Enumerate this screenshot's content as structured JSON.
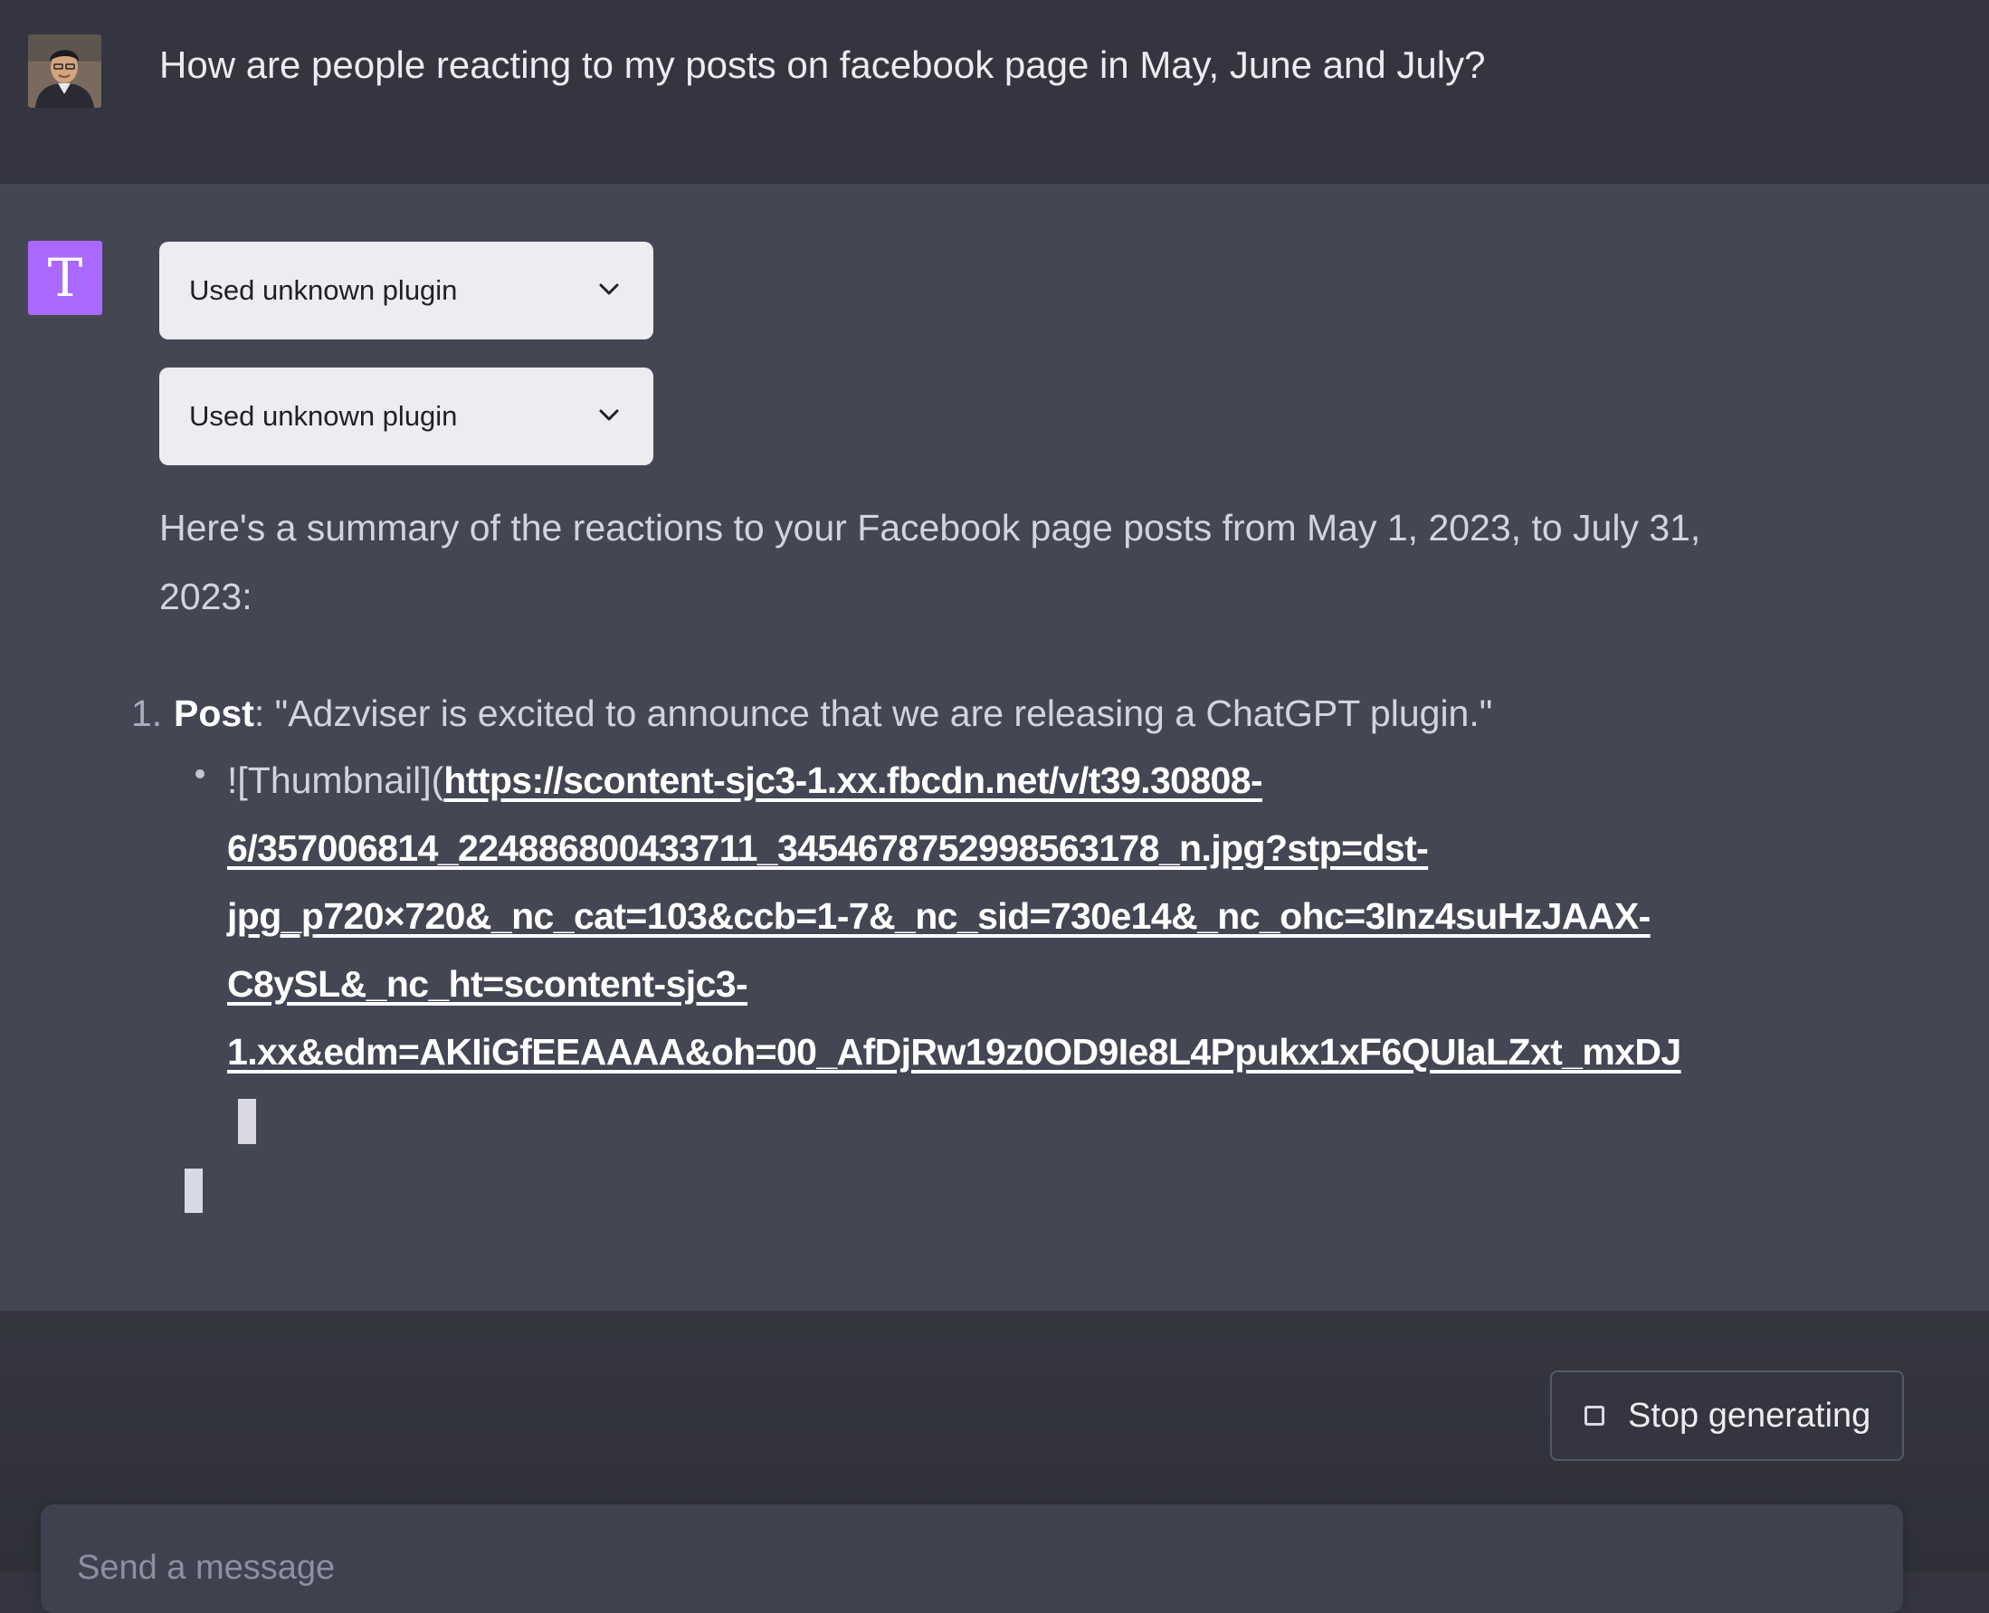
{
  "user_message": {
    "text": "How are people reacting to my posts on facebook page in May, June and July?"
  },
  "assistant": {
    "avatar_letter": "T",
    "plugins": [
      {
        "label": "Used unknown plugin",
        "icon": "chevron-down-icon"
      },
      {
        "label": "Used unknown plugin",
        "icon": "chevron-down-icon"
      }
    ],
    "summary": "Here's a summary of the reactions to your Facebook page posts from May 1, 2023, to July 31, 2023:",
    "list": {
      "number": "1.",
      "post_label": "Post",
      "post_text": ": \"Adzviser is excited to announce that we are releasing a ChatGPT plugin.\"",
      "thumbnail_prefix": "![Thumbnail](",
      "url_lines": [
        "https://scontent-sjc3-1.xx.fbcdn.net/v/t39.30808-",
        "6/357006814_224886800433711_3454678752998563178_n.jpg?stp=dst-",
        "jpg_p720×720&_nc_cat=103&ccb=1-7&_nc_sid=730e14&_nc_ohc=3Inz4suHzJAAX-",
        "C8ySL&_nc_ht=scontent-sjc3-",
        "1.xx&edm=AKIiGfEEAAAA&oh=00_AfDjRw19z0OD9Ie8L4Ppukx1xF6QUIaLZxt_mxDJ"
      ]
    }
  },
  "controls": {
    "stop_label": "Stop generating",
    "stop_icon": "stop-square-icon",
    "input_placeholder": "Send a message"
  },
  "colors": {
    "background": "#343541",
    "assistant_background": "#444654",
    "assistant_avatar": "#ab68ff",
    "plugin_box": "#ececf1"
  }
}
